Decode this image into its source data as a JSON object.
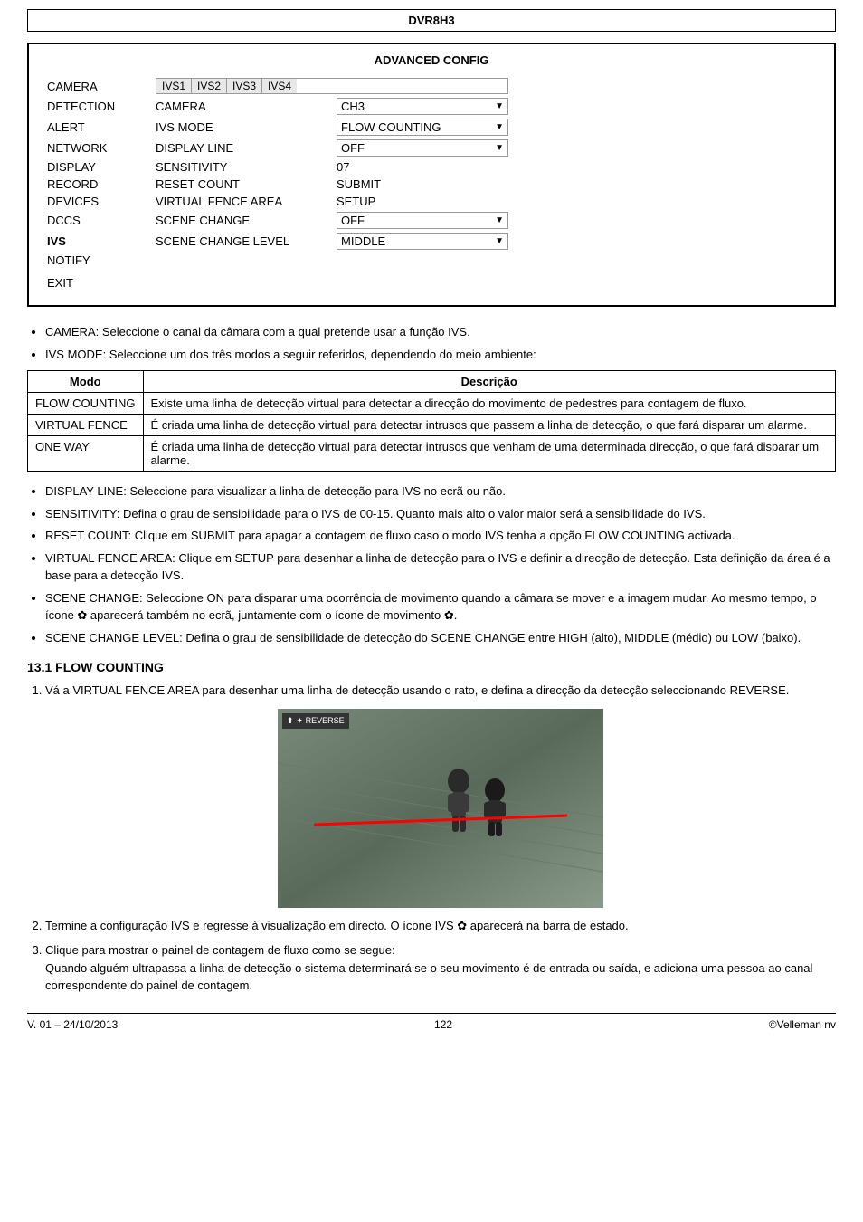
{
  "header": {
    "title": "DVR8H3"
  },
  "advanced_config": {
    "title": "ADVANCED CONFIG",
    "camera_tabs": [
      "IVS1",
      "IVS2",
      "IVS3",
      "IVS4"
    ],
    "rows": [
      {
        "left": "CAMERA",
        "mid": "",
        "right": ""
      },
      {
        "left": "DETECTION",
        "mid": "CAMERA",
        "right_value": "CH3",
        "right_dropdown": true
      },
      {
        "left": "ALERT",
        "mid": "IVS MODE",
        "right_value": "FLOW COUNTING",
        "right_dropdown": true
      },
      {
        "left": "NETWORK",
        "mid": "DISPLAY LINE",
        "right_value": "OFF",
        "right_dropdown": true
      },
      {
        "left": "DISPLAY",
        "mid": "SENSITIVITY",
        "right_value": "07",
        "right_dropdown": false
      },
      {
        "left": "RECORD",
        "mid": "RESET COUNT",
        "right_value": "SUBMIT",
        "right_dropdown": false
      },
      {
        "left": "DEVICES",
        "mid": "VIRTUAL FENCE AREA",
        "right_value": "SETUP",
        "right_dropdown": false
      },
      {
        "left": "DCCS",
        "mid": "SCENE CHANGE",
        "right_value": "OFF",
        "right_dropdown": true
      },
      {
        "left": "IVS",
        "mid": "SCENE CHANGE LEVEL",
        "right_value": "MIDDLE",
        "right_dropdown": true,
        "left_bold": true
      },
      {
        "left": "NOTIFY",
        "mid": "",
        "right_value": "",
        "right_dropdown": false
      }
    ],
    "exit_label": "EXIT"
  },
  "bullets": [
    "CAMERA: Seleccione o canal da câmara com a qual pretende usar a função IVS.",
    "IVS MODE: Seleccione um dos três modos a seguir referidos, dependendo do meio ambiente:"
  ],
  "mode_table": {
    "headers": [
      "Modo",
      "Descrição"
    ],
    "rows": [
      {
        "mode": "FLOW COUNTING",
        "description": "Existe uma linha de detecção virtual para detectar a direcção do movimento de pedestres para contagem de fluxo."
      },
      {
        "mode": "VIRTUAL FENCE",
        "description": "É criada uma linha de detecção virtual para detectar intrusos que passem a linha de detecção, o que fará disparar um alarme."
      },
      {
        "mode": "ONE WAY",
        "description": "É criada uma linha de detecção virtual para detectar intrusos que venham de uma determinada direcção, o que fará disparar um alarme."
      }
    ]
  },
  "bullets2": [
    "DISPLAY LINE: Seleccione para visualizar a linha de detecção para IVS no ecrã ou não.",
    "SENSITIVITY: Defina o grau de sensibilidade para o IVS de 00-15. Quanto mais alto o valor maior será a sensibilidade do IVS.",
    "RESET COUNT: Clique em SUBMIT para apagar a contagem de fluxo caso o modo IVS tenha a opção FLOW COUNTING activada.",
    "VIRTUAL FENCE AREA: Clique em SETUP para desenhar a linha de detecção para o IVS e definir a direcção de detecção. Esta definição da área é a base para a detecção IVS.",
    "SCENE CHANGE: Seleccione ON para disparar uma ocorrência de movimento quando a câmara se mover e a imagem mudar. Ao mesmo tempo, o ícone ✿ aparecerá também no ecrã, juntamente com o ícone de movimento ✿.",
    "SCENE CHANGE LEVEL: Defina o grau de sensibilidade de detecção do SCENE CHANGE entre HIGH (alto), MIDDLE (médio) ou LOW (baixo)."
  ],
  "section_13_1": {
    "heading": "13.1  FLOW COUNTING",
    "step1": "Vá a VIRTUAL FENCE AREA para desenhar uma linha de detecção usando o rato, e defina a direcção da detecção seleccionando REVERSE.",
    "reverse_label": "✦ REVERSE",
    "step2": "Termine a configuração IVS e regresse à visualização em directo. O ícone IVS ✿ aparecerá na barra de estado.",
    "step3_line1": "Clique para mostrar o painel de contagem de fluxo como se segue:",
    "step3_line2": "Quando alguém ultrapassa a linha de detecção o sistema determinará se o seu movimento é de entrada ou saída, e adiciona uma pessoa ao canal correspondente do painel de contagem."
  },
  "footer": {
    "version": "V. 01 – 24/10/2013",
    "page_number": "122",
    "copyright": "©Velleman nv"
  }
}
